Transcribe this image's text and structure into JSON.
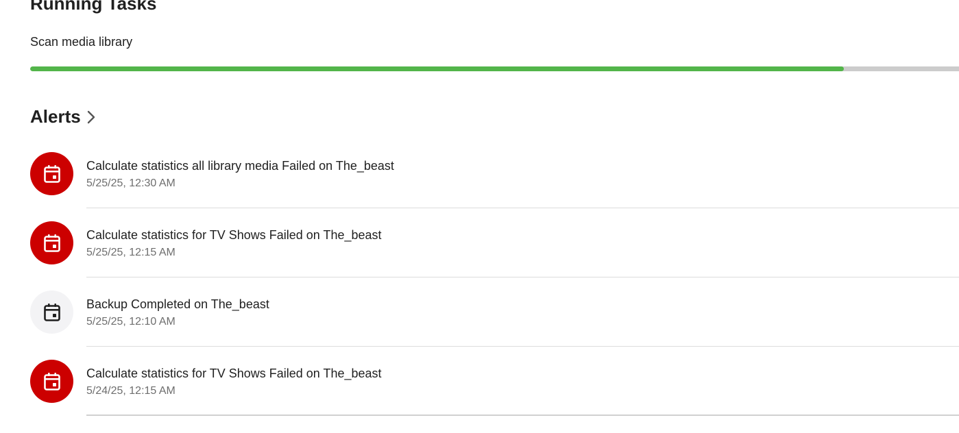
{
  "running_tasks": {
    "title": "Running Tasks",
    "tasks": [
      {
        "name": "Scan media library",
        "progress": 0.876
      }
    ]
  },
  "alerts": {
    "title": "Alerts",
    "items": [
      {
        "title": "Calculate statistics all library media Failed on The_beast",
        "time": "5/25/25, 12:30 AM",
        "severity": "error",
        "icon": "calendar-event-icon"
      },
      {
        "title": "Calculate statistics for TV Shows Failed on The_beast",
        "time": "5/25/25, 12:15 AM",
        "severity": "error",
        "icon": "calendar-event-icon"
      },
      {
        "title": "Backup Completed on The_beast",
        "time": "5/25/25, 12:10 AM",
        "severity": "info",
        "icon": "calendar-event-icon"
      },
      {
        "title": "Calculate statistics for TV Shows Failed on The_beast",
        "time": "5/24/25, 12:15 AM",
        "severity": "error",
        "icon": "calendar-event-icon"
      }
    ]
  },
  "colors": {
    "progress_fill": "#53b54a",
    "progress_track": "#cccccc",
    "error": "#cc0000",
    "info_bg": "#f3f3f5"
  }
}
